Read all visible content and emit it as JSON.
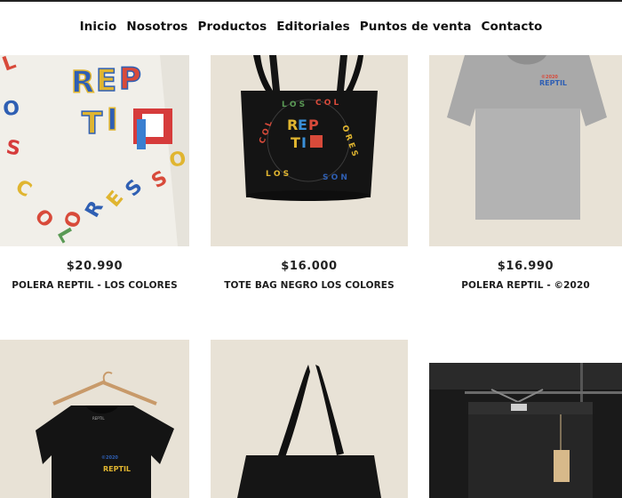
{
  "nav": {
    "items": [
      "Inicio",
      "Nosotros",
      "Productos",
      "Editoriales",
      "Puntos de venta",
      "Contacto"
    ]
  },
  "products": [
    {
      "price": "$20.990",
      "name": "POLERA REPTIL - LOS COLORES",
      "image": "white-tshirt-closeup-print"
    },
    {
      "price": "$16.000",
      "name": "TOTE BAG NEGRO LOS COLORES",
      "image": "black-tote-bag-print"
    },
    {
      "price": "$16.990",
      "name": "POLERA REPTIL - ©2020",
      "image": "grey-tshirt"
    },
    {
      "price": "",
      "name": "",
      "image": "black-tshirt-on-hanger"
    },
    {
      "price": "",
      "name": "",
      "image": "black-tote-bag-plain"
    },
    {
      "price": "",
      "name": "",
      "image": "black-jeans-on-rack"
    }
  ],
  "artwork": {
    "brand": "REP TI L",
    "circle_text": "LOS COLORES SON",
    "small_logo": "REPTIL"
  },
  "colors": {
    "card_bg": "#e8e2d6",
    "nav_text": "#111111"
  }
}
